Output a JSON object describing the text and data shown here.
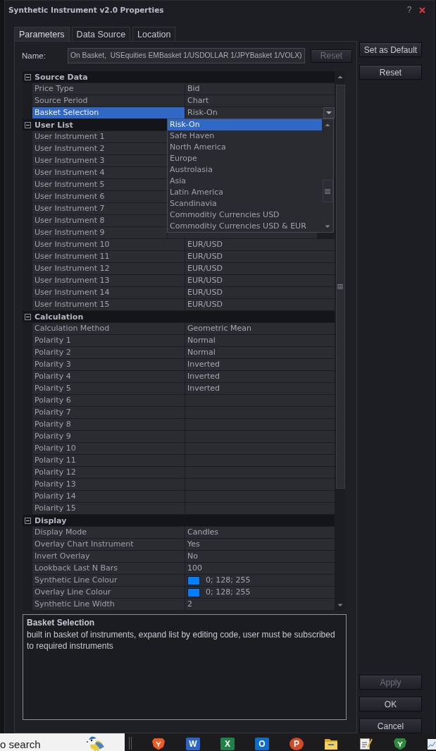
{
  "window": {
    "title": "Synthetic Instrument v2.0 Properties",
    "help": "?"
  },
  "tabs": [
    {
      "label": "Parameters",
      "selected": true
    },
    {
      "label": "Data Source",
      "selected": false
    },
    {
      "label": "Location",
      "selected": false
    }
  ],
  "name_field": {
    "label": "Name:",
    "value": "On Basket,  USEquities EMBasket 1/USDOLLAR 1/JPYBasket 1/VOLX)",
    "reset_button": {
      "label": "Reset",
      "disabled": true
    }
  },
  "property_grid": {
    "sections": [
      {
        "title": "Source Data",
        "expanded": true,
        "rows": [
          {
            "kind": "text",
            "label": "Price Type",
            "value": "Bid",
            "selected": false
          },
          {
            "kind": "text",
            "label": "Source Period",
            "value": "Chart",
            "selected": false
          },
          {
            "kind": "dropdown",
            "label": "Basket Selection",
            "value": "Risk-On",
            "selected": true,
            "expanded": true,
            "options": [
              {
                "label": "Risk-On",
                "selected": true
              },
              {
                "label": "Safe Haven",
                "selected": false
              },
              {
                "label": "North America",
                "selected": false
              },
              {
                "label": "Europe",
                "selected": false
              },
              {
                "label": "Austrolasia",
                "selected": false
              },
              {
                "label": "Asia",
                "selected": false
              },
              {
                "label": "Latin America",
                "selected": false
              },
              {
                "label": "Scandinavia",
                "selected": false
              },
              {
                "label": "Commoditiy Currencies USD",
                "selected": false
              },
              {
                "label": "Commoditiy Currencies USD & EUR",
                "selected": false
              }
            ]
          }
        ]
      },
      {
        "title": "User List",
        "expanded": true,
        "rows": [
          {
            "kind": "text",
            "label": "User Instrument 1",
            "selected": false
          },
          {
            "kind": "text",
            "label": "User Instrument 2",
            "selected": false
          },
          {
            "kind": "text",
            "label": "User Instrument 3",
            "selected": false
          },
          {
            "kind": "text",
            "label": "User Instrument 4",
            "selected": false
          },
          {
            "kind": "text",
            "label": "User Instrument 5",
            "selected": false
          },
          {
            "kind": "text",
            "label": "User Instrument 6",
            "selected": false
          },
          {
            "kind": "text",
            "label": "User Instrument 7",
            "selected": false
          },
          {
            "kind": "text",
            "label": "User Instrument 8",
            "selected": false
          },
          {
            "kind": "text",
            "label": "User Instrument 9",
            "selected": false
          },
          {
            "kind": "text",
            "label": "User Instrument 10",
            "value": "EUR/USD",
            "selected": false
          },
          {
            "kind": "text",
            "label": "User Instrument 11",
            "value": "EUR/USD",
            "selected": false
          },
          {
            "kind": "text",
            "label": "User Instrument 12",
            "value": "EUR/USD",
            "selected": false
          },
          {
            "kind": "text",
            "label": "User Instrument 13",
            "value": "EUR/USD",
            "selected": false
          },
          {
            "kind": "text",
            "label": "User Instrument 14",
            "value": "EUR/USD",
            "selected": false
          },
          {
            "kind": "text",
            "label": "User Instrument 15",
            "value": "EUR/USD",
            "selected": false
          }
        ]
      },
      {
        "title": "Calculation",
        "expanded": true,
        "rows": [
          {
            "kind": "text",
            "label": "Calculation Method",
            "value": "Geometric Mean",
            "selected": false
          },
          {
            "kind": "text",
            "label": "Polarity 1",
            "value": "Normal",
            "selected": false
          },
          {
            "kind": "text",
            "label": "Polarity 2",
            "value": "Normal",
            "selected": false
          },
          {
            "kind": "text",
            "label": "Polarity 3",
            "value": "Inverted",
            "selected": false
          },
          {
            "kind": "text",
            "label": "Polarity 4",
            "value": "Inverted",
            "selected": false
          },
          {
            "kind": "text",
            "label": "Polarity 5",
            "value": "Inverted",
            "selected": false
          },
          {
            "kind": "text",
            "label": "Polarity 6",
            "selected": false
          },
          {
            "kind": "text",
            "label": "Polarity 7",
            "selected": false
          },
          {
            "kind": "text",
            "label": "Polarity 8",
            "selected": false
          },
          {
            "kind": "text",
            "label": "Polarity 9",
            "selected": false
          },
          {
            "kind": "text",
            "label": "Polarity 10",
            "selected": false
          },
          {
            "kind": "text",
            "label": "Polarity 11",
            "selected": false
          },
          {
            "kind": "text",
            "label": "Polarity 12",
            "selected": false
          },
          {
            "kind": "text",
            "label": "Polarity 13",
            "selected": false
          },
          {
            "kind": "text",
            "label": "Polarity 14",
            "selected": false
          },
          {
            "kind": "text",
            "label": "Polarity 15",
            "selected": false
          }
        ]
      },
      {
        "title": "Display",
        "expanded": true,
        "rows": [
          {
            "kind": "text",
            "label": "Display Mode",
            "value": "Candles",
            "selected": false
          },
          {
            "kind": "text",
            "label": "Overlay Chart Instrument",
            "value": "Yes",
            "selected": false
          },
          {
            "kind": "text",
            "label": "Invert Overlay",
            "value": "No",
            "selected": false
          },
          {
            "kind": "text",
            "label": "Lookback Last N Bars",
            "value": "100",
            "selected": false
          },
          {
            "kind": "color",
            "label": "Synthetic Line Colour",
            "value": "0; 128; 255",
            "color": "#0080ff",
            "selected": false
          },
          {
            "kind": "color",
            "label": "Overlay Line Colour",
            "value": "0; 128; 255",
            "color": "#0080ff",
            "selected": false
          },
          {
            "kind": "text",
            "label": "Synthetic Line Width",
            "value": "2",
            "selected": false
          }
        ]
      }
    ]
  },
  "description": {
    "title": "Basket Selection",
    "text": "built in basket of instruments, expand list by editing code, user must be subscribed to required instruments"
  },
  "side_buttons": [
    {
      "label": "Set as Default",
      "disabled": false
    },
    {
      "label": "Reset",
      "disabled": false
    }
  ],
  "dialog_buttons": [
    {
      "label": "Apply",
      "disabled": true
    },
    {
      "label": "OK",
      "disabled": false
    },
    {
      "label": "Cancel",
      "disabled": false
    }
  ],
  "taskbar": {
    "search": {
      "placeholder": "o search"
    },
    "apps": [
      {
        "kind": "shield",
        "color": "#f05a24"
      },
      {
        "kind": "tile",
        "glyph": "W",
        "color": "#2b63c6"
      },
      {
        "kind": "tile",
        "glyph": "X",
        "color": "#1f8048"
      },
      {
        "kind": "tile",
        "glyph": "O",
        "color": "#0f6cc9"
      },
      {
        "kind": "disc",
        "glyph": "P",
        "color": "#d24a26"
      },
      {
        "kind": "folder"
      },
      {
        "kind": "notepad"
      },
      {
        "kind": "shield",
        "color": "#2e8b3e"
      },
      {
        "kind": "chart"
      }
    ]
  }
}
